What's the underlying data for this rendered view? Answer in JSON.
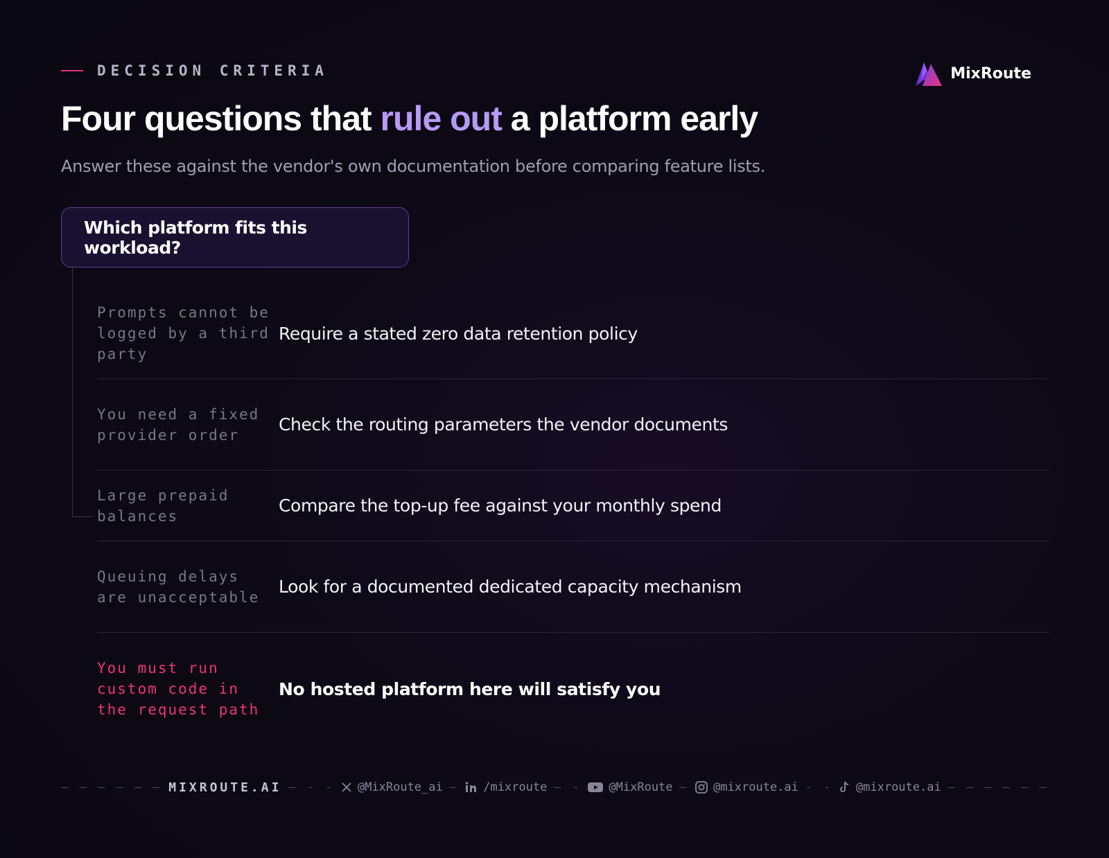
{
  "eyebrow": "DECISION CRITERIA",
  "brand": {
    "name": "MixRoute",
    "logo_icon": "mountain-logo-icon"
  },
  "title": {
    "before": "Four questions that ",
    "highlight": "rule out",
    "after": " a platform early"
  },
  "subtitle": "Answer these against the vendor's own documentation before comparing feature lists.",
  "question": "Which platform fits this workload?",
  "rows": [
    {
      "condition": "Prompts cannot be logged by a third party",
      "action": "Require a stated zero data retention policy"
    },
    {
      "condition": "You need a fixed provider order",
      "action": "Check the routing parameters the vendor documents"
    },
    {
      "condition": "Large prepaid balances",
      "action": "Compare the top-up fee against your monthly spend"
    },
    {
      "condition": "Queuing delays are unacceptable",
      "action": "Look for a documented dedicated capacity mechanism"
    },
    {
      "condition": "You must run custom code in the request path",
      "action": "No hosted platform here will satisfy you"
    }
  ],
  "footer": {
    "site": "MIXROUTE.AI",
    "x": "@MixRoute_ai",
    "linkedin": "/mixroute",
    "youtube": "@MixRoute",
    "instagram": "@mixroute.ai",
    "tiktok": "@mixroute.ai"
  },
  "colors": {
    "accent": "#b79af5",
    "alert": "#f0337a",
    "dash": "#e8337a",
    "background": "#0a0812"
  }
}
